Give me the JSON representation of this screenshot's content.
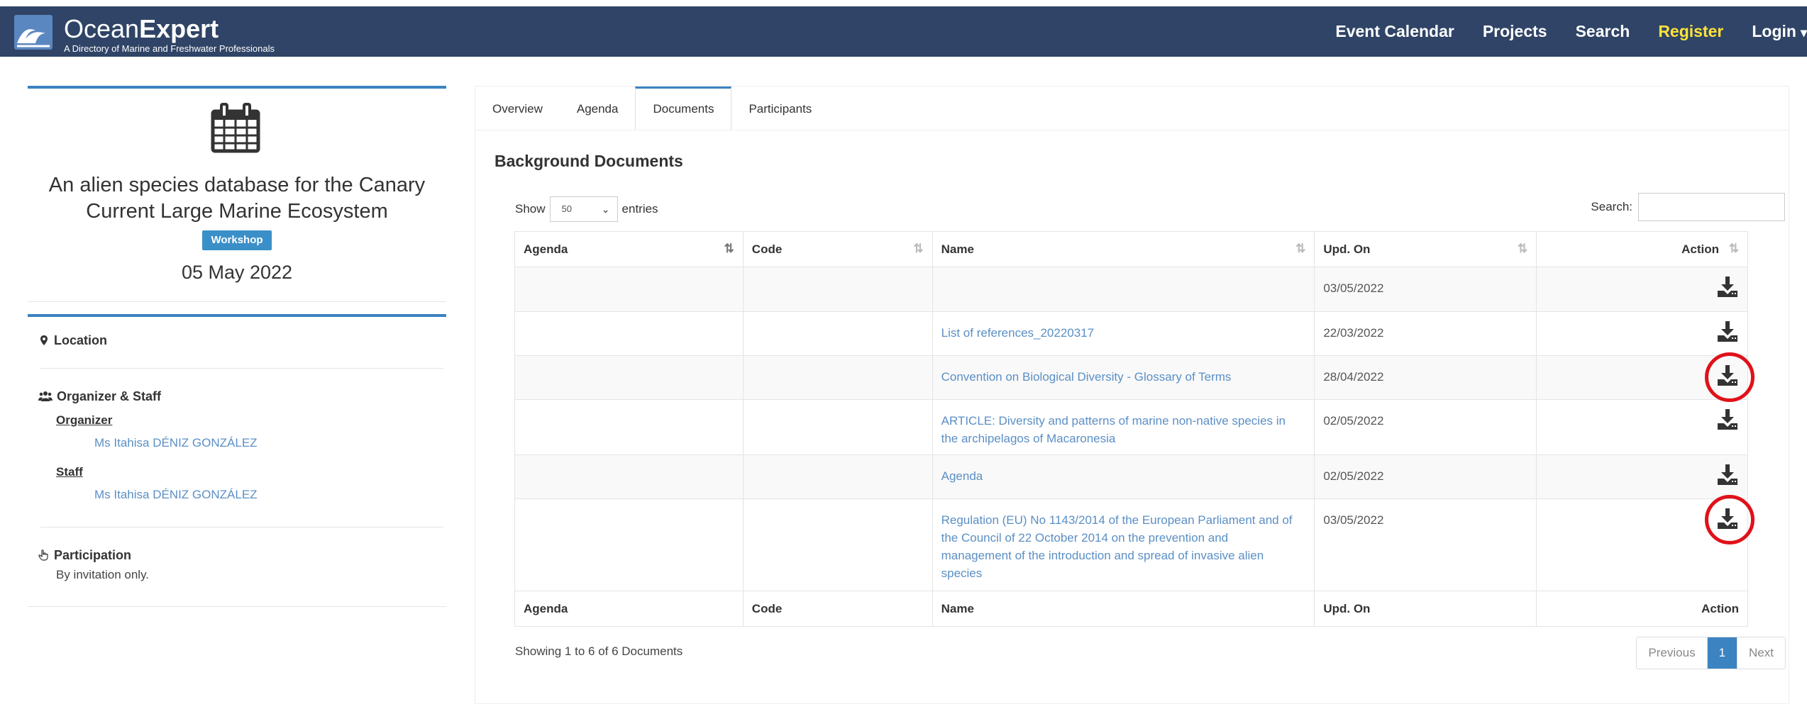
{
  "header": {
    "brand_light": "Ocean",
    "brand_bold": "Expert",
    "tagline": "A Directory of Marine and Freshwater Professionals",
    "nav": {
      "event_calendar": "Event Calendar",
      "projects": "Projects",
      "search": "Search",
      "register": "Register",
      "login": "Login"
    }
  },
  "event": {
    "title_line1": "An alien species database for the Canary",
    "title_line2": "Current Large Marine Ecosystem",
    "type_badge": "Workshop",
    "date": "05 May 2022",
    "location_label": "Location",
    "organizer_staff_label": "Organizer & Staff",
    "organizer_role": "Organizer",
    "organizer_name": "Ms Itahisa DÉNIZ GONZÁLEZ",
    "staff_role": "Staff",
    "staff_name": "Ms Itahisa DÉNIZ GONZÁLEZ",
    "participation_label": "Participation",
    "participation_value": "By invitation only."
  },
  "tabs": [
    "Overview",
    "Agenda",
    "Documents",
    "Participants"
  ],
  "documents": {
    "section_title": "Background Documents",
    "show_label": "Show",
    "entries_value": "50",
    "entries_label": "entries",
    "search_label": "Search:",
    "columns": [
      "Agenda",
      "Code",
      "Name",
      "Upd. On",
      "Action"
    ],
    "rows": [
      {
        "agenda": "",
        "code": "",
        "name_lines": [],
        "updated": "03/05/2022"
      },
      {
        "agenda": "",
        "code": "",
        "name_lines": [
          "List of references_20220317"
        ],
        "updated": "22/03/2022"
      },
      {
        "agenda": "",
        "code": "",
        "name_lines": [
          "Convention on Biological Diversity - Glossary of Terms"
        ],
        "updated": "28/04/2022"
      },
      {
        "agenda": "",
        "code": "",
        "name_lines": [
          "ARTICLE: Diversity and patterns of marine non-native species in",
          "the archipelagos of Macaronesia"
        ],
        "updated": "02/05/2022"
      },
      {
        "agenda": "",
        "code": "",
        "name_lines": [
          "Agenda"
        ],
        "updated": "02/05/2022"
      },
      {
        "agenda": "",
        "code": "",
        "name_lines": [
          "Regulation (EU) No 1143/2014 of the European Parliament and of",
          "the Council of 22 October 2014 on the prevention and",
          "management of the introduction and spread of invasive alien",
          "species"
        ],
        "updated": "03/05/2022"
      }
    ],
    "info": "Showing 1 to 6 of 6 Documents",
    "pager": {
      "previous": "Previous",
      "current": "1",
      "next": "Next"
    }
  },
  "colors": {
    "navbar": "#2f4466",
    "accent": "#3b83c1",
    "register": "#ffe23a",
    "link": "#5b8fc5",
    "highlight": "#e0111a"
  }
}
